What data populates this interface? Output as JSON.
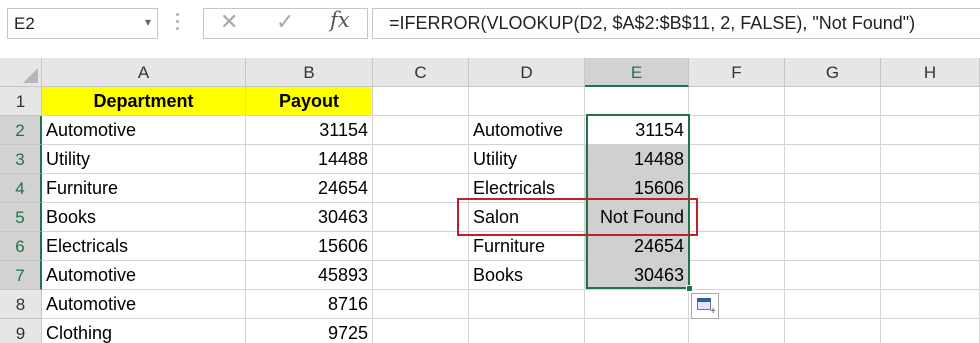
{
  "formula_bar": {
    "name_box": "E2",
    "cancel_glyph": "✕",
    "enter_glyph": "✓",
    "fx_label": "fx",
    "formula": "=IFERROR(VLOOKUP(D2, $A$2:$B$11, 2, FALSE), \"Not Found\")"
  },
  "columns": [
    "A",
    "B",
    "C",
    "D",
    "E",
    "F",
    "G",
    "H"
  ],
  "selected_column": "E",
  "rows": [
    "1",
    "2",
    "3",
    "4",
    "5",
    "6",
    "7",
    "8",
    "9"
  ],
  "cells": {
    "A1": "Department",
    "B1": "Payout",
    "A2": "Automotive",
    "B2": "31154",
    "A3": "Utility",
    "B3": "14488",
    "A4": "Furniture",
    "B4": "24654",
    "A5": "Books",
    "B5": "30463",
    "A6": "Electricals",
    "B6": "15606",
    "A7": "Automotive",
    "B7": "45893",
    "A8": "Automotive",
    "B8": "8716",
    "A9": "Clothing",
    "B9": "9725",
    "D2": "Automotive",
    "E2": "31154",
    "D3": "Utility",
    "E3": "14488",
    "D4": "Electricals",
    "E4": "15606",
    "D5": "Salon",
    "E5": "Not Found",
    "D6": "Furniture",
    "E6": "24654",
    "D7": "Books",
    "E7": "30463"
  },
  "selection": "E2:E7",
  "highlight": "D5:E5",
  "colors": {
    "header_fill": "#ffff00",
    "selection_border": "#217346",
    "highlight_border": "#c0202a",
    "selected_cell_shade": "#d0d0d0"
  },
  "icons": {
    "cancel": "cancel-icon",
    "enter": "enter-icon",
    "function": "fx-icon",
    "quick_analysis": "quick-analysis-icon",
    "dropdown": "chevron-down-icon"
  }
}
